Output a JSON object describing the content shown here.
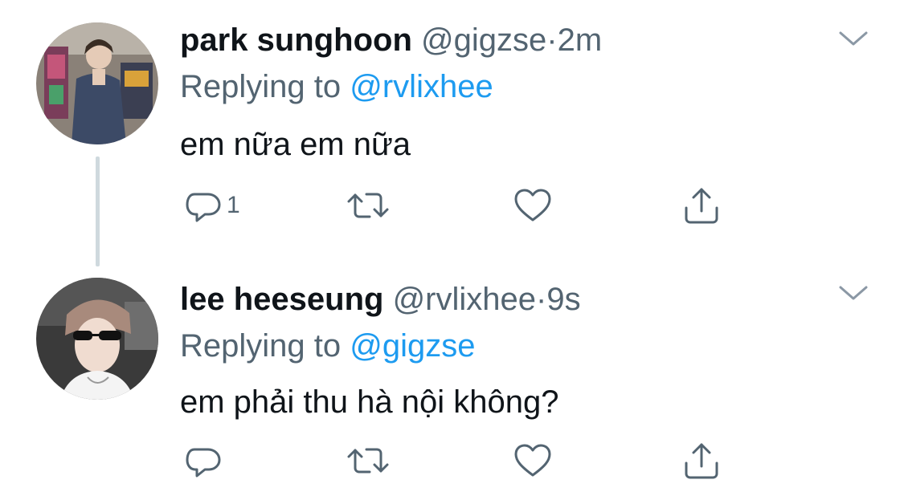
{
  "tweets": [
    {
      "name": "park sunghoon",
      "handle": "@gigzse",
      "separator": "·",
      "time": "2m",
      "replying_prefix": "Replying to",
      "replying_to": "@rvlixhee",
      "text": "em nữa em nữa",
      "reply_count": "1",
      "icons": {
        "reply": "reply-icon",
        "retweet": "retweet-icon",
        "like": "heart-icon",
        "share": "share-icon",
        "menu": "chevron-down-icon"
      }
    },
    {
      "name": "lee heeseung",
      "handle": "@rvlixhee",
      "separator": "·",
      "time": "9s",
      "replying_prefix": "Replying to",
      "replying_to": "@gigzse",
      "text": "em phải thu hà nội không?",
      "reply_count": "",
      "icons": {
        "reply": "reply-icon",
        "retweet": "retweet-icon",
        "like": "heart-icon",
        "share": "share-icon",
        "menu": "chevron-down-icon"
      }
    }
  ],
  "colors": {
    "text": "#0f1419",
    "secondary": "#536471",
    "link": "#1d9bf0",
    "thread_line": "#cfd9de"
  }
}
